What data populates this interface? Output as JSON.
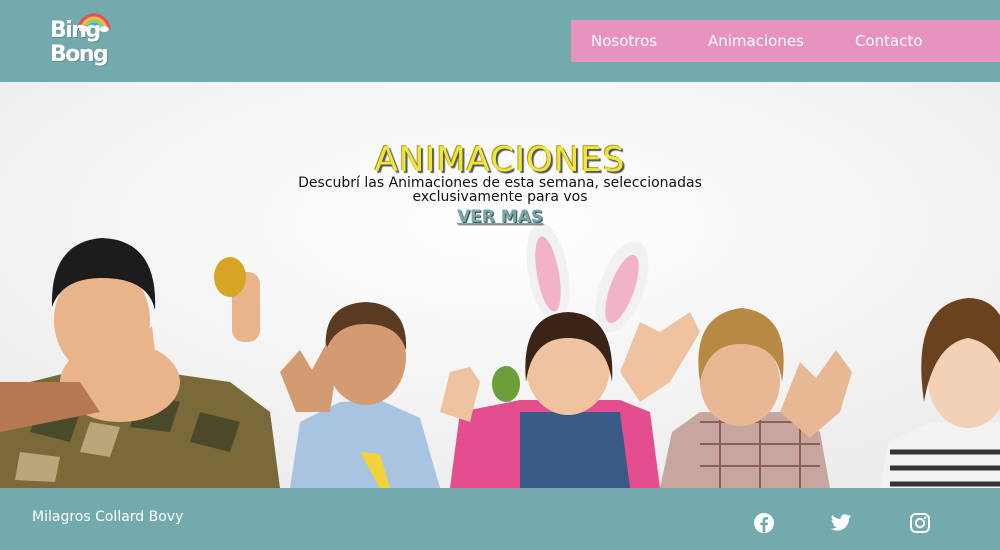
{
  "header": {
    "logo": {
      "line1": "Bing",
      "line2": "Bong"
    },
    "nav": [
      {
        "label": "Nosotros"
      },
      {
        "label": "Animaciones"
      },
      {
        "label": "Contacto"
      }
    ]
  },
  "hero": {
    "title": "ANIMACIONES",
    "subtitle": "Descubrí las Animaciones de esta semana, seleccionadas exclusivamente para vos",
    "cta": "VER MAS"
  },
  "footer": {
    "author": "Milagros Collard Bovy",
    "social": [
      "facebook-icon",
      "twitter-icon",
      "instagram-icon"
    ]
  },
  "colors": {
    "teal": "#73aaae",
    "pink": "#e693bf",
    "title_yellow": "#f2e53a",
    "white": "#ffffff"
  }
}
